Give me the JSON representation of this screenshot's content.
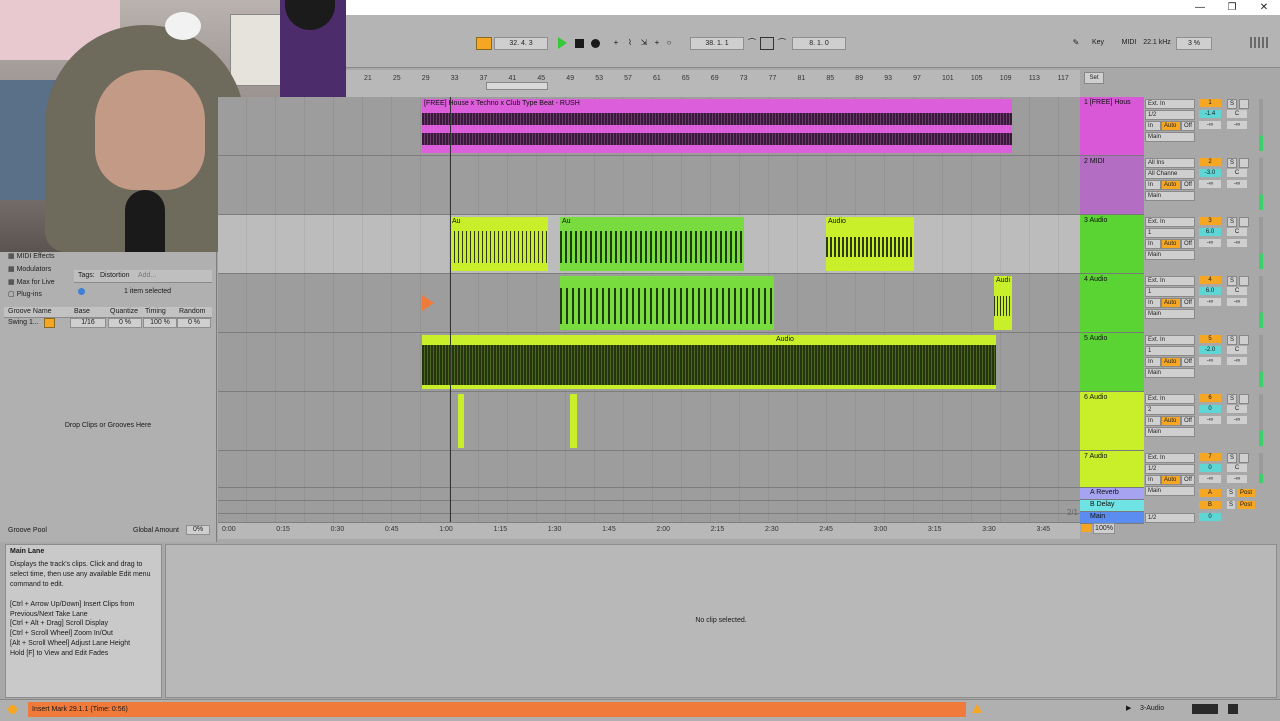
{
  "window": {
    "min_label": "—",
    "max_label": "❐",
    "close_label": "✕"
  },
  "control": {
    "position": "32.   4.   3",
    "loop_start": "38.   1.   1",
    "loop_length": "8.   1.   0",
    "key_label": "Key",
    "midi_label": "MIDI",
    "sample_rate": "22.1 kHz",
    "cpu": "3 %"
  },
  "ruler": {
    "bars": [
      "21",
      "25",
      "29",
      "33",
      "37",
      "41",
      "45",
      "49",
      "53",
      "57",
      "61",
      "65",
      "69",
      "73",
      "77",
      "81",
      "85",
      "89",
      "93",
      "97",
      "101",
      "105",
      "109",
      "113",
      "117"
    ],
    "set_label": "Set"
  },
  "time_ruler": {
    "times": [
      "0:00",
      "0:15",
      "0:30",
      "0:45",
      "1:00",
      "1:15",
      "1:30",
      "1:45",
      "2:00",
      "2:15",
      "2:30",
      "2:45",
      "3:00",
      "3:15",
      "3:30",
      "3:45"
    ],
    "page": "2/1"
  },
  "clips": {
    "track1_clip": "[FREE] House x Techno x Club Type Beat - RUSH",
    "audio_short": "Au",
    "audio_label": "Audio",
    "track4_clip": "Audi"
  },
  "tracks": [
    {
      "name": "1 [FREE] Hous",
      "input": "Ext. In",
      "channel": "1/2",
      "out": "Main",
      "num": "1",
      "vol": "-1.4",
      "pan": "C",
      "color": "#d958d8"
    },
    {
      "name": "2 MIDI",
      "input": "All Ins",
      "channel": "All Channe",
      "out": "Main",
      "num": "2",
      "vol": "-3.0",
      "pan": "C",
      "color": "#b36ec4"
    },
    {
      "name": "3 Audio",
      "input": "Ext. In",
      "channel": "1",
      "out": "Main",
      "num": "3",
      "vol": "6.0",
      "pan": "C",
      "color": "#5ad433"
    },
    {
      "name": "4 Audio",
      "input": "Ext. In",
      "channel": "1",
      "out": "Main",
      "num": "4",
      "vol": "6.0",
      "pan": "C",
      "color": "#5ad433"
    },
    {
      "name": "5 Audio",
      "input": "Ext. In",
      "channel": "1",
      "out": "Main",
      "num": "5",
      "vol": "-2.0",
      "pan": "C",
      "color": "#5ad433"
    },
    {
      "name": "6 Audio",
      "input": "Ext. In",
      "channel": "2",
      "out": "Main",
      "num": "6",
      "vol": "0",
      "pan": "C",
      "color": "#c8ef2a"
    },
    {
      "name": "7 Audio",
      "input": "Ext. In",
      "channel": "1/2",
      "out": "Main",
      "num": "7",
      "vol": "0",
      "pan": "C",
      "color": "#c8ef2a"
    }
  ],
  "returns": [
    {
      "name": "A Reverb",
      "letter": "A",
      "post": "Post",
      "color": "#a6a3f0"
    },
    {
      "name": "B Delay",
      "letter": "B",
      "post": "Post",
      "color": "#6fe3e3"
    },
    {
      "name": "Main",
      "input": "1/2",
      "vol": "0",
      "color": "#5b8cf0"
    }
  ],
  "track_controls": {
    "in": "In",
    "auto": "Auto",
    "off": "Off",
    "solo": "S",
    "inf": "-∞"
  },
  "browser": {
    "items": [
      "MIDI Effects",
      "Modulators",
      "Max for Live",
      "Plug-ins"
    ],
    "tags_label": "Tags:",
    "tag_distortion": "Distortion",
    "tag_add": "Add...",
    "selected": "1 item selected",
    "groove_headers": [
      "Groove Name",
      "Base",
      "Quantize",
      "Timing",
      "Random"
    ],
    "groove_row": {
      "name": "Swing 1...",
      "base": "1/16",
      "quantize": "0 %",
      "timing": "100 %",
      "random": "0 %"
    },
    "drop_hint": "Drop Clips or Grooves Here",
    "groove_pool": "Groove Pool",
    "global_amount_label": "Global Amount",
    "global_amount": "0%"
  },
  "info": {
    "title": "Main Lane",
    "body1": "Displays the track's clips. Click and drag to select time, then use any available Edit menu command to edit.",
    "body2": "[Ctrl + Arrow Up/Down] Insert Clips from Previous/Next Take Lane",
    "body3": "[Ctrl + Alt + Drag] Scroll Display",
    "body4": "[Ctrl + Scroll Wheel] Zoom In/Out",
    "body5": "[Alt + Scroll Wheel] Adjust Lane Height",
    "body6": "Hold [F] to View and Edit Fades"
  },
  "detail": {
    "empty": "No clip selected."
  },
  "status": {
    "message": "Insert Mark 29.1.1 (Time: 0:56)",
    "track": "3-Audio"
  },
  "master_zoom": "100%",
  "colors": {
    "accent": "#f5a623",
    "status_bar": "#f07a3a",
    "play": "#37c837"
  }
}
